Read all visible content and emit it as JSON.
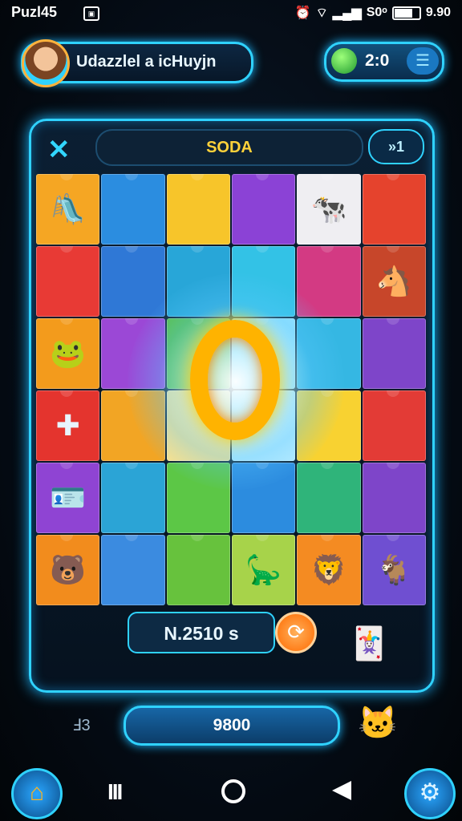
{
  "status": {
    "app": "Puzl45",
    "badge": "▣",
    "battery_text": "S0ᵒ",
    "time": "9.90"
  },
  "player": {
    "name": "Udazzlel a icHuyjn",
    "score": "2:0",
    "menu_icon": "☰"
  },
  "board": {
    "close_icon": "✕",
    "title": "SODA",
    "level": "»1",
    "timer": "N.2510 s",
    "hint_icon": "⟳"
  },
  "tiles": [
    {
      "color": "#f5a623",
      "art": "🛝"
    },
    {
      "color": "#2b8de0",
      "art": ""
    },
    {
      "color": "#f7c52a",
      "art": ""
    },
    {
      "color": "#8b42d6",
      "art": ""
    },
    {
      "color": "#efeef2",
      "art": "🐄"
    },
    {
      "color": "#e5432d",
      "art": ""
    },
    {
      "color": "#e83a35",
      "art": ""
    },
    {
      "color": "#2f78d6",
      "art": ""
    },
    {
      "color": "#28a6d8",
      "art": ""
    },
    {
      "color": "#33c2e6",
      "art": ""
    },
    {
      "color": "#d33a83",
      "art": ""
    },
    {
      "color": "#c7462a",
      "art": "🐴"
    },
    {
      "color": "#f39b1c",
      "art": "🐸"
    },
    {
      "color": "#9b48d6",
      "art": ""
    },
    {
      "color": "#59bf3c",
      "art": ""
    },
    {
      "color": "#9be5ff",
      "art": ""
    },
    {
      "color": "#35b7e3",
      "art": ""
    },
    {
      "color": "#7e45c9",
      "art": ""
    },
    {
      "color": "#e4342e",
      "art": "✚"
    },
    {
      "color": "#f2a524",
      "art": ""
    },
    {
      "color": "#ffe28a",
      "art": ""
    },
    {
      "color": "#b9ecff",
      "art": ""
    },
    {
      "color": "#f8d231",
      "art": ""
    },
    {
      "color": "#e33b36",
      "art": ""
    },
    {
      "color": "#8f44d3",
      "art": "🪪"
    },
    {
      "color": "#2ba4d6",
      "art": ""
    },
    {
      "color": "#5cc746",
      "art": ""
    },
    {
      "color": "#2c8cdf",
      "art": ""
    },
    {
      "color": "#2fb47a",
      "art": ""
    },
    {
      "color": "#7e45c9",
      "art": ""
    },
    {
      "color": "#f28c1d",
      "art": "🐻"
    },
    {
      "color": "#3b8be0",
      "art": ""
    },
    {
      "color": "#67c23d",
      "art": ""
    },
    {
      "color": "#a7d34a",
      "art": "🦕"
    },
    {
      "color": "#f48b22",
      "art": "🦁"
    },
    {
      "color": "#6f4fd1",
      "art": "🐐"
    },
    {
      "color": "#2f9a3e",
      "art": ""
    },
    {
      "color": "#9b48d6",
      "art": "🎠"
    },
    {
      "color": "#f2a524",
      "art": "🦎"
    },
    {
      "color": "#e9ecf3",
      "art": "🦜"
    },
    {
      "color": "#e5332c",
      "art": ""
    },
    {
      "color": "#5fb247",
      "art": "🧑"
    }
  ],
  "player_avatar_icon": "avatar-icon",
  "coins": {
    "left_label": "Ⅎ3",
    "value": "9800"
  },
  "nav": {
    "home_icon": "⌂",
    "recent_icon": "III",
    "settings_icon": "⚙"
  },
  "colors": {
    "accent": "#2fd2ff",
    "gold": "#ffb300",
    "title": "#ffd23a"
  }
}
